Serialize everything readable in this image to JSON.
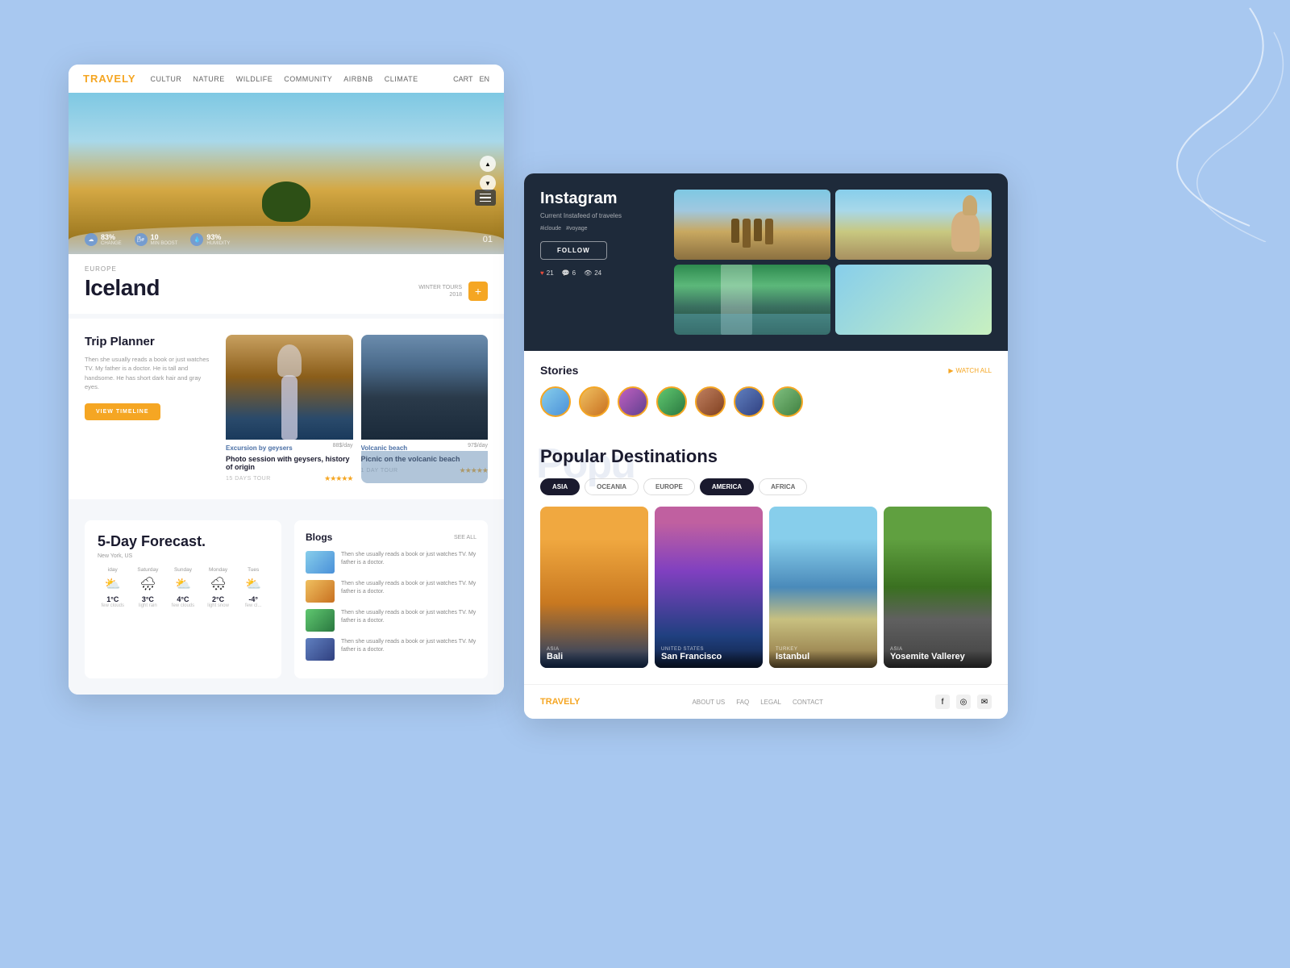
{
  "background": "#a8c8f0",
  "left_panel": {
    "nav": {
      "logo": "TRAVELY",
      "links": [
        "CULTUR",
        "NATURE",
        "WILDLIFE",
        "COMMUNITY",
        "AIRBNB",
        "CLIMATE"
      ],
      "right": [
        "CART",
        "EN"
      ]
    },
    "hero": {
      "stats": [
        {
          "icon": "☁",
          "label": "CHANGE",
          "value": "83%"
        },
        {
          "icon": "🌬",
          "label": "MIN BOOST",
          "value": "10"
        },
        {
          "icon": "💧",
          "label": "HUMIDITY",
          "value": "93%"
        }
      ],
      "number": "01"
    },
    "destination": {
      "region": "EUROPE",
      "title": "Iceland",
      "winter_label": "WINTER TOURS\n2018"
    },
    "trip_planner": {
      "title": "Trip Planner",
      "description": "Then she usually reads a book or just watches TV. My father is a doctor. He is tall and handsome. He has short dark hair and gray eyes.",
      "btn_label": "VIEW TIMELINE"
    },
    "tours": [
      {
        "label": "Excursion by geysers",
        "price": "88$/day",
        "name": "Photo session with geysers, history of origin",
        "days": "15 DAYS TOUR",
        "stars": 5
      },
      {
        "label": "Volcanic beach",
        "price": "97$/day",
        "name": "Picnic on the volcanic beach",
        "days": "1 DAY TOUR",
        "stars": 5
      }
    ],
    "weather": {
      "title": "5-Day Forecast.",
      "location": "New York, US",
      "days": [
        {
          "name": "iday",
          "temp": "1°C",
          "desc": "few clouds",
          "icon": "⛅"
        },
        {
          "name": "Saturday",
          "temp": "3°C",
          "desc": "light rain",
          "icon": "🌧"
        },
        {
          "name": "Sunday",
          "temp": "4°C",
          "desc": "few clouds",
          "icon": "⛅"
        },
        {
          "name": "Monday",
          "temp": "2°C",
          "desc": "light snow",
          "icon": "🌨"
        },
        {
          "name": "Tues",
          "temp": "-4°",
          "desc": "few cl...",
          "icon": "⛅"
        }
      ]
    },
    "blogs": {
      "title": "Blogs",
      "see_all": "SEE ALL",
      "items": [
        "Then she usually reads a book or just watches TV. My father is a doctor.",
        "Then she usually reads a book or just watches TV. My father is a doctor.",
        "Then she usually reads a book or just watches TV. My father is a doctor.",
        "Then she usually reads a book or just watches TV. My father is a doctor."
      ]
    }
  },
  "right_panel": {
    "instagram": {
      "title": "Instagram",
      "subtitle": "Current Instafeed of traveles",
      "tags": [
        "#icloude",
        "#voyage"
      ],
      "follow_label": "FOLLOW",
      "stats": [
        {
          "icon": "♥",
          "value": "21"
        },
        {
          "icon": "💬",
          "value": "6"
        },
        {
          "icon": "👁",
          "value": "24"
        }
      ]
    },
    "stories": {
      "title": "Stories",
      "watch_all": "WATCH ALL"
    },
    "popular": {
      "bg_text": "Pop",
      "title": "Popular Destinations",
      "tabs": [
        "ASIA",
        "OCEANIA",
        "EUROPE",
        "AMERICA",
        "AFRICA"
      ],
      "active_tab": "ASIA",
      "active_tab2": "AMERICA",
      "destinations": [
        {
          "region": "ASIA",
          "city": "Bali"
        },
        {
          "region": "UNITED STATES",
          "city": "San Francisco"
        },
        {
          "region": "TURKEY",
          "city": "Istanbul"
        },
        {
          "region": "ASIA",
          "city": "Yosemite Vallerey"
        }
      ]
    },
    "footer": {
      "logo": "TRAVELY",
      "links": [
        "ABOUT US",
        "FAQ",
        "LEGAL",
        "CONTACT"
      ]
    }
  }
}
